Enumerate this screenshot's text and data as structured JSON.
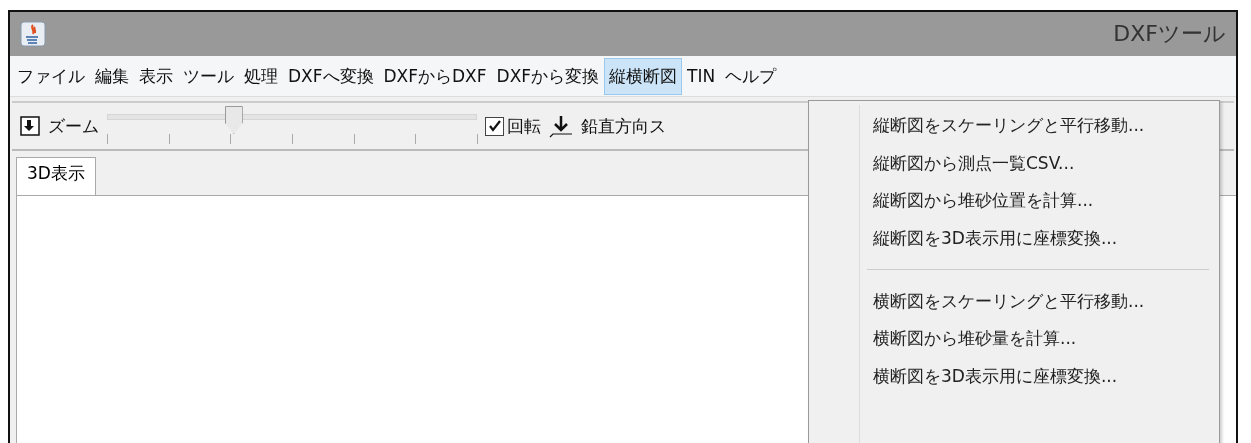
{
  "window": {
    "title": "DXFツール"
  },
  "menu_bar": [
    {
      "label": "ファイル",
      "selected": false
    },
    {
      "label": "編集",
      "selected": false
    },
    {
      "label": "表示",
      "selected": false
    },
    {
      "label": "ツール",
      "selected": false
    },
    {
      "label": "処理",
      "selected": false
    },
    {
      "label": "DXFへ変換",
      "selected": false
    },
    {
      "label": "DXFからDXF",
      "selected": false
    },
    {
      "label": "DXFから変換",
      "selected": false
    },
    {
      "label": "縦横断図",
      "selected": true
    },
    {
      "label": "TIN",
      "selected": false
    },
    {
      "label": "ヘルプ",
      "selected": false
    }
  ],
  "toolbar": {
    "zoom_label": "ズーム",
    "zoom": {
      "level": 0.34
    },
    "rotate": {
      "label": "回転",
      "checked": true
    },
    "vertical_label": "鉛直方向ス"
  },
  "tabs": [
    {
      "label": "3D表示",
      "selected": true
    }
  ],
  "dropdown": [
    {
      "kind": "item",
      "label": "縦断図をスケーリングと平行移動..."
    },
    {
      "kind": "item",
      "label": "縦断図から測点一覧CSV..."
    },
    {
      "kind": "item",
      "label": "縦断図から堆砂位置を計算..."
    },
    {
      "kind": "item",
      "label": "縦断図を3D表示用に座標変換..."
    },
    {
      "kind": "separator"
    },
    {
      "kind": "item",
      "label": "横断図をスケーリングと平行移動..."
    },
    {
      "kind": "item",
      "label": "横断図から堆砂量を計算..."
    },
    {
      "kind": "item",
      "label": "横断図を3D表示用に座標変換..."
    }
  ]
}
